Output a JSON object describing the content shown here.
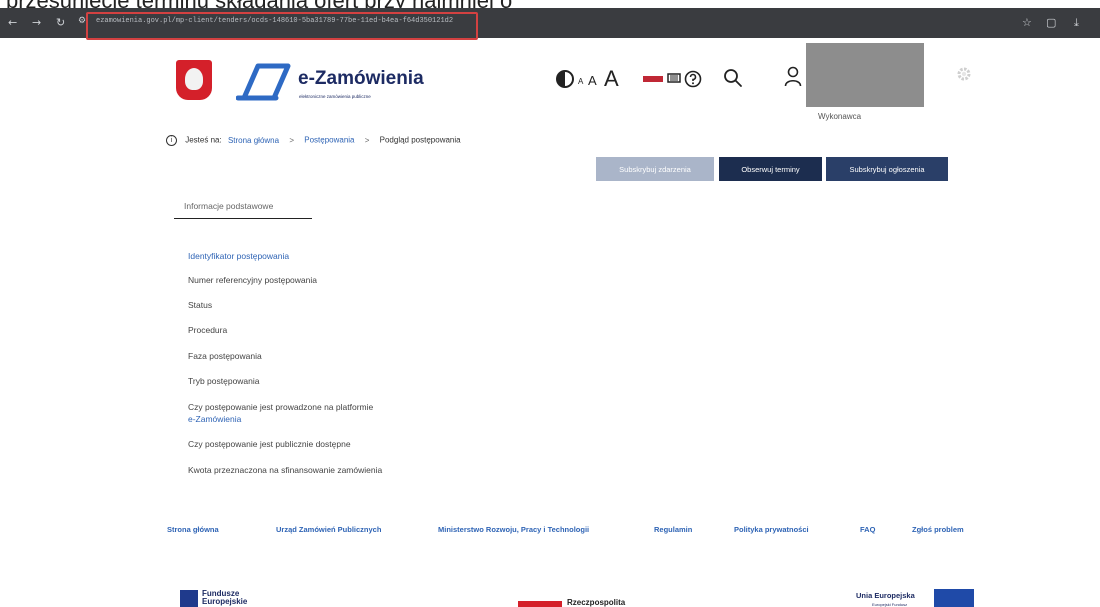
{
  "document": {
    "caption": "przesunięcie terminu składania ofert przy najmniej o"
  },
  "browser": {
    "url": "ezamowienia.gov.pl/mp-client/tenders/ocds-148610-5ba31789-77be-11ed-b4ea-f64d350121d2",
    "nav_icons": [
      "back-icon",
      "forward-icon",
      "reload-icon",
      "site-info-icon"
    ],
    "toolbar_icons": [
      "star-icon",
      "extension-icon",
      "download-icon"
    ],
    "highlight_color": "#d34141"
  },
  "header": {
    "logo_title": "e-Zamówienia",
    "logo_subtitle": "elektroniczne zamówienia publiczne",
    "font_size_small": "A",
    "font_size_medium": "A",
    "font_size_large": "A",
    "user_role": "Wykonawca",
    "accent_color": "#1d2b63"
  },
  "breadcrumb": {
    "prefix": "Jesteś na:",
    "items": [
      "Strona główna",
      "Postępowania",
      "Podgląd postępowania"
    ],
    "separator": ">"
  },
  "actions": {
    "subscribe_events": "Subskrybuj zdarzenia",
    "watch_deadlines": "Obserwuj terminy",
    "subscribe_notices": "Subskrybuj ogłoszenia"
  },
  "tabs": {
    "basic_info": "Informacje podstawowe"
  },
  "fields": [
    "Identyfikator postępowania",
    "Numer referencyjny postępowania",
    "Status",
    "Procedura",
    "Faza postępowania",
    "Tryb postępowania",
    "Czy postępowanie jest prowadzone na platformie",
    "e-Zamówienia",
    "Czy postępowanie jest publicznie dostępne",
    "Kwota przeznaczona na sfinansowanie zamówienia"
  ],
  "footer": {
    "links": [
      "Strona główna",
      "Urząd Zamówień Publicznych",
      "Ministerstwo Rozwoju, Pracy i Technologii",
      "Regulamin",
      "Polityka prywatności",
      "FAQ",
      "Zgłoś problem"
    ],
    "funds_line1": "Fundusze",
    "funds_line2": "Europejskie",
    "rp_text": "Rzeczpospolita",
    "eu_text": "Unia Europejska",
    "eu_sub": "Europejski Fundusz"
  }
}
